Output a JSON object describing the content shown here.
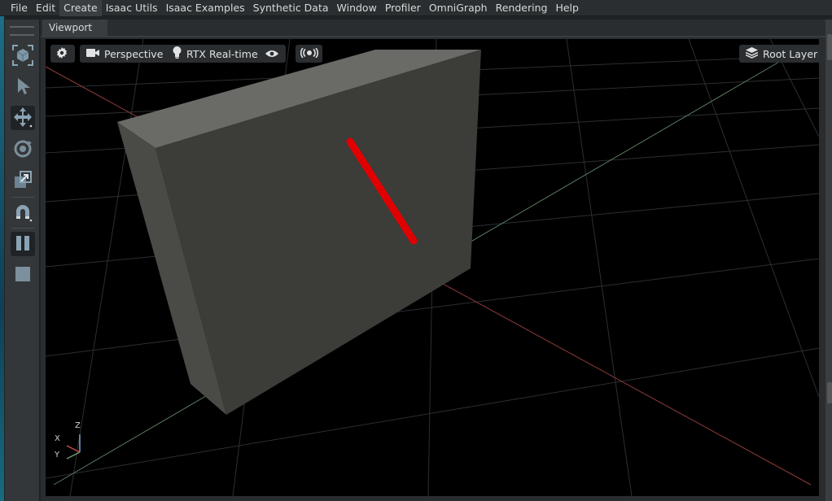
{
  "menubar": {
    "items": [
      "File",
      "Edit",
      "Create",
      "Isaac Utils",
      "Isaac Examples",
      "Synthetic Data",
      "Window",
      "Profiler",
      "OmniGraph",
      "Rendering",
      "Help"
    ],
    "active_item": "Create"
  },
  "toolbar": {
    "tools": [
      {
        "name": "select-frame-icon",
        "state": "normal"
      },
      {
        "name": "select-arrow-icon",
        "state": "normal"
      },
      {
        "name": "move-icon",
        "state": "active"
      },
      {
        "name": "rotate-icon",
        "state": "normal"
      },
      {
        "name": "scale-icon",
        "state": "normal"
      },
      {
        "name": "snap-magnet-icon",
        "state": "normal"
      },
      {
        "name": "pause-icon",
        "state": "active"
      },
      {
        "name": "stop-icon",
        "state": "normal"
      }
    ]
  },
  "viewport": {
    "tab_label": "Viewport",
    "camera_label": "Perspective",
    "render_mode_label": "RTX Real-time",
    "layer_label": "Root Layer",
    "axis_labels": {
      "x": "X",
      "y": "Y",
      "z": "Z"
    }
  },
  "colors": {
    "menubar_bg": "#2b2e30",
    "viewport_bg": "#000000",
    "grid_line": "#2c2f31",
    "x_axis": "#8e3b3b",
    "y_axis": "#5d7d61",
    "box_front": "#3d3d3a",
    "box_top": "#6a6a66",
    "red_stick": "#e10000"
  }
}
